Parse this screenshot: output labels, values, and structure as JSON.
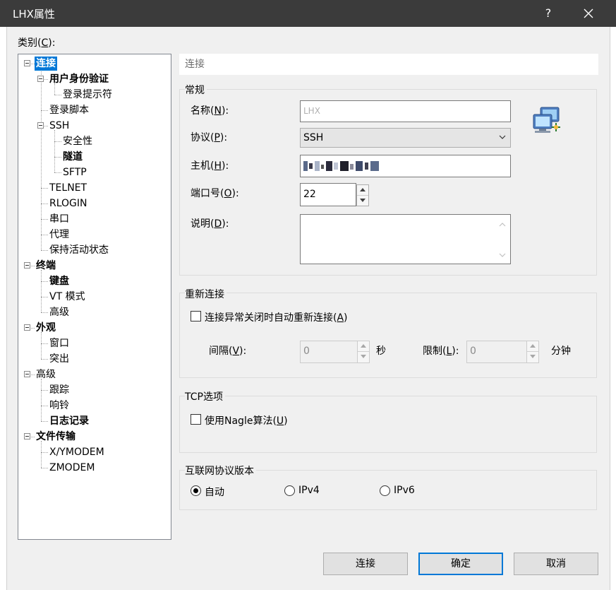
{
  "window": {
    "title": "LHX属性",
    "help_label": "?"
  },
  "category": {
    "label_pre": "类别(",
    "key": "C",
    "label_post": "):"
  },
  "tree": [
    {
      "label": "连接",
      "level": 0,
      "bold": true,
      "selected": true
    },
    {
      "label": "用户身份验证",
      "level": 1,
      "bold": true
    },
    {
      "label": "登录提示符",
      "level": 2
    },
    {
      "label": "登录脚本",
      "level": 1
    },
    {
      "label": "SSH",
      "level": 1
    },
    {
      "label": "安全性",
      "level": 2
    },
    {
      "label": "隧道",
      "level": 2,
      "bold": true
    },
    {
      "label": "SFTP",
      "level": 2
    },
    {
      "label": "TELNET",
      "level": 1
    },
    {
      "label": "RLOGIN",
      "level": 1
    },
    {
      "label": "串口",
      "level": 1
    },
    {
      "label": "代理",
      "level": 1
    },
    {
      "label": "保持活动状态",
      "level": 1
    },
    {
      "label": "终端",
      "level": 0,
      "bold": true
    },
    {
      "label": "键盘",
      "level": 1,
      "bold": true
    },
    {
      "label": "VT 模式",
      "level": 1
    },
    {
      "label": "高级",
      "level": 1
    },
    {
      "label": "外观",
      "level": 0,
      "bold": true
    },
    {
      "label": "窗口",
      "level": 1
    },
    {
      "label": "突出",
      "level": 1
    },
    {
      "label": "高级",
      "level": 0
    },
    {
      "label": "跟踪",
      "level": 1
    },
    {
      "label": "响铃",
      "level": 1
    },
    {
      "label": "日志记录",
      "level": 1,
      "bold": true
    },
    {
      "label": "文件传输",
      "level": 0,
      "bold": true
    },
    {
      "label": "X/YMODEM",
      "level": 1
    },
    {
      "label": "ZMODEM",
      "level": 1
    }
  ],
  "panel_title": "连接",
  "general": {
    "title": "常规",
    "name_label": "名称(",
    "name_key": "N",
    "name_post": "):",
    "name_value": "LHX",
    "protocol_label": "协议(",
    "protocol_key": "P",
    "protocol_post": "):",
    "protocol_value": "SSH",
    "host_label": "主机(",
    "host_key": "H",
    "host_post": "):",
    "port_label": "端口号(",
    "port_key": "O",
    "port_post": "):",
    "port_value": "22",
    "desc_label": "说明(",
    "desc_key": "D",
    "desc_post": "):",
    "desc_value": ""
  },
  "reconnect": {
    "title": "重新连接",
    "checkbox_label": "连接异常关闭时自动重新连接(",
    "checkbox_key": "A",
    "checkbox_post": ")",
    "checked": false,
    "interval_label": "间隔(",
    "interval_key": "V",
    "interval_post": "):",
    "interval_value": "0",
    "interval_unit": "秒",
    "limit_label": "限制(",
    "limit_key": "L",
    "limit_post": "):",
    "limit_value": "0",
    "limit_unit": "分钟"
  },
  "tcp": {
    "title": "TCP选项",
    "checkbox_label": "使用Nagle算法(",
    "checkbox_key": "U",
    "checkbox_post": ")",
    "checked": false
  },
  "ip": {
    "title": "互联网协议版本",
    "options": [
      "自动",
      "IPv4",
      "IPv6"
    ],
    "selected": "自动"
  },
  "buttons": {
    "connect": "连接",
    "ok": "确定",
    "cancel": "取消"
  },
  "colors": {
    "selection": "#0078d7",
    "titlebar": "#3b3b3b"
  }
}
